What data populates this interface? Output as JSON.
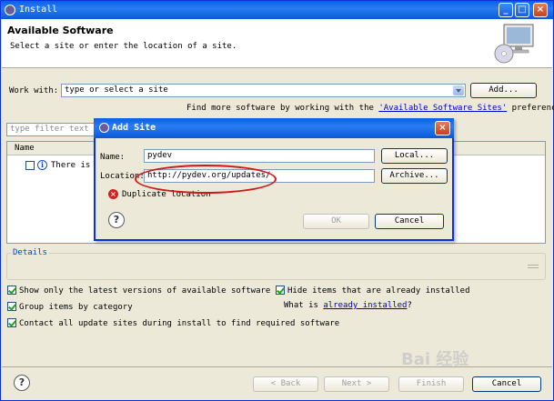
{
  "window": {
    "title": "Install",
    "controls": {
      "minimize": "_",
      "maximize": "□",
      "close": "×"
    }
  },
  "banner": {
    "title": "Available Software",
    "subtitle": "Select a site or enter the location of a site."
  },
  "work_with": {
    "label": "Work with:",
    "placeholder": "type or select a site",
    "add_button": "Add...",
    "find_more_prefix": "Find more software by working with the",
    "find_more_link": "'Available Software Sites'",
    "find_more_suffix": "preferences."
  },
  "filter": {
    "placeholder": "type filter text"
  },
  "table": {
    "header_name": "Name",
    "row_text": "There is n"
  },
  "details": {
    "legend": "Details"
  },
  "options": {
    "show_latest": "Show only the latest versions of available software",
    "hide_installed": "Hide items that are already installed",
    "group_by_category": "Group items by category",
    "what_is_prefix": "What is",
    "already_installed_link": "already installed",
    "what_is_suffix": "?",
    "contact_sites": "Contact all update sites during install to find required software"
  },
  "footer": {
    "back": "< Back",
    "next": "Next >",
    "finish": "Finish",
    "cancel": "Cancel"
  },
  "dialog": {
    "title": "Add Site",
    "close": "×",
    "name_label": "Name:",
    "name_value": "pydev",
    "local_button": "Local...",
    "location_label": "Location:",
    "location_value": "http://pydev.org/updates/",
    "archive_button": "Archive...",
    "error_text": "Duplicate location",
    "ok_button": "OK",
    "cancel_button": "Cancel"
  },
  "watermark": "Bai 经验",
  "icons": {
    "help": "?",
    "info": "i",
    "error": "×"
  }
}
